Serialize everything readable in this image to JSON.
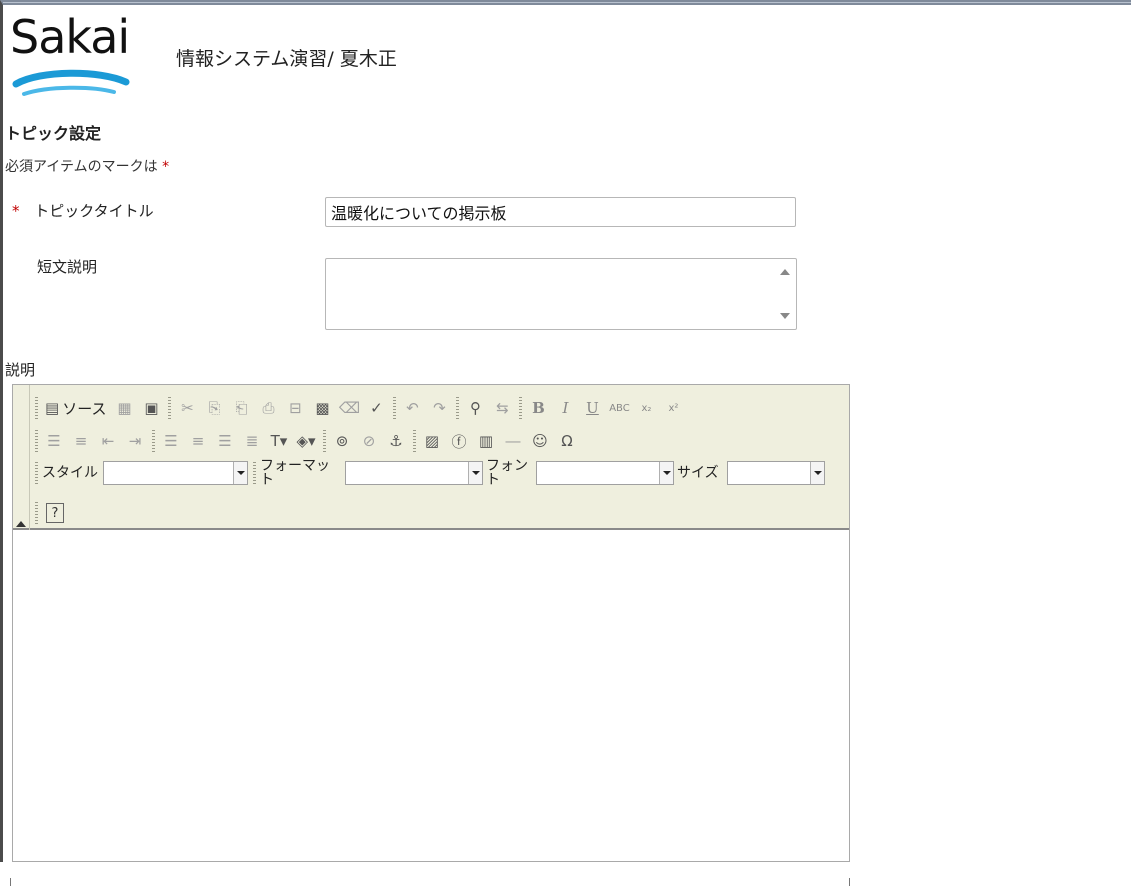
{
  "header": {
    "logo_text": "Sakai",
    "site_title": "情報システム演習/ 夏木正"
  },
  "form": {
    "section_title": "トピック設定",
    "required_note": "必須アイテムのマークは",
    "required_mark": "*",
    "topic_title_label": "トピックタイトル",
    "topic_title_value": "温暖化についての掲示板",
    "short_desc_label": "短文説明",
    "short_desc_value": "",
    "description_label": "説明"
  },
  "editor": {
    "toolbar": {
      "source_label": "ソース",
      "style_label": "スタイル",
      "format_label": "フォーマット",
      "font_label": "フォント",
      "size_label": "サイズ",
      "style_value": "",
      "format_value": "",
      "font_value": "",
      "size_value": ""
    },
    "body_text": ""
  },
  "icons": [
    "source-icon",
    "template-icon",
    "paste-icon",
    "cut-icon",
    "copy-icon",
    "paste-text-icon",
    "paste-word-icon",
    "print-icon",
    "select-all-icon",
    "remove-format-icon",
    "spellcheck-icon",
    "undo-icon",
    "redo-icon",
    "find-icon",
    "replace-icon",
    "bold-icon",
    "italic-icon",
    "underline-icon",
    "strike-icon",
    "subscript-icon",
    "superscript-icon",
    "ordered-list-icon",
    "unordered-list-icon",
    "outdent-icon",
    "indent-icon",
    "align-left-icon",
    "align-center-icon",
    "align-right-icon",
    "align-justify-icon",
    "text-color-icon",
    "bg-color-icon",
    "link-icon",
    "unlink-icon",
    "anchor-icon",
    "image-icon",
    "flash-icon",
    "table-icon",
    "horizontal-rule-icon",
    "smiley-icon",
    "special-char-icon",
    "help-icon"
  ],
  "colors": {
    "toolbar_bg": "#efefde",
    "required": "#c00000",
    "logo_swoosh": "#1b9ad6"
  }
}
